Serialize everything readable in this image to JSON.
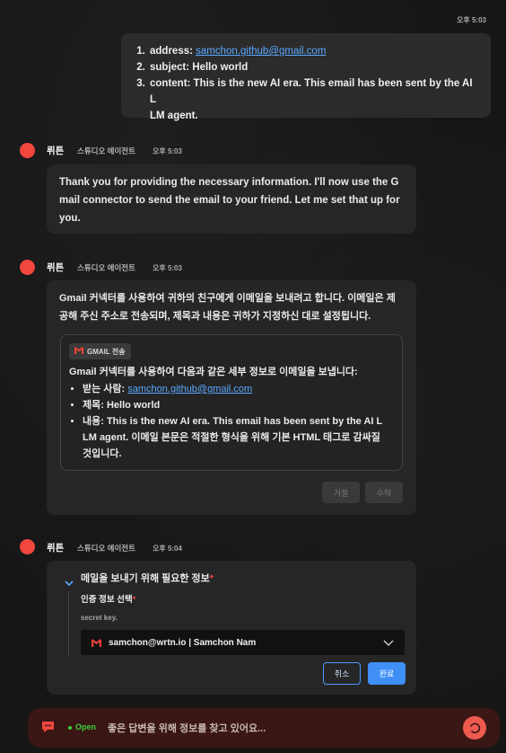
{
  "user_message": {
    "time": "오후 5:03",
    "items": [
      {
        "label": "address: ",
        "link": "samchon.github@gmail.com"
      },
      {
        "label": "subject: Hello world"
      },
      {
        "label": "content: This is the new AI era. This email has been sent by the AI L",
        "cont": "LM agent."
      }
    ]
  },
  "agent": {
    "name": "뤼튼",
    "role": "스튜디오 에이전트"
  },
  "messages": [
    {
      "time": "오후 5:03",
      "lines": [
        "Thank you for providing the necessary information. I'll now use the G",
        "mail connector to send the email to your friend. Let me set that up for",
        "you."
      ]
    },
    {
      "time": "오후 5:03",
      "lines": [
        "Gmail 커넥터를 사용하여 귀하의 친구에게 이메일을 보내려고 합니다. 이메일은 제",
        "공해 주신 주소로 전송되며, 제목과 내용은 귀하가 지정하신 대로 설정됩니다."
      ],
      "tool": {
        "tag": "GMAIL 전송",
        "heading": "Gmail 커넥터를 사용하여 다음과 같은 세부 정보로 이메일을 보냅니다:",
        "bullets": [
          {
            "label": "받는 사람: ",
            "link": "samchon.github@gmail.com"
          },
          {
            "label": "제목: Hello world"
          },
          {
            "label": "내용: This is the new AI era. This email has been sent by the AI L",
            "cont1": "LM agent. 이메일 본문은 적절한 형식을 위해 기본 HTML 태그로 감싸질",
            "cont2": "것입니다."
          }
        ],
        "reject_label": "거절",
        "accept_label": "수락"
      }
    },
    {
      "time": "오후 5:04",
      "form": {
        "section_title": "메일을 보내기 위해 필요한 정보",
        "required_mark": "*",
        "field_label": "인증 정보 선택",
        "field_hint": "secret key.",
        "selected_value": "samchon@wrtn.io | Samchon Nam",
        "cancel_label": "취소",
        "confirm_label": "완료"
      }
    }
  ],
  "input_bar": {
    "status": "Open",
    "placeholder": "좋은 답변을 위해 정보를 찾고 있어요..."
  },
  "colors": {
    "accent": "#f2473d",
    "link": "#5aa9ff",
    "primary_button": "#3f8ff7",
    "status_green": "#3ad13a",
    "input_bg": "#3a1714"
  }
}
